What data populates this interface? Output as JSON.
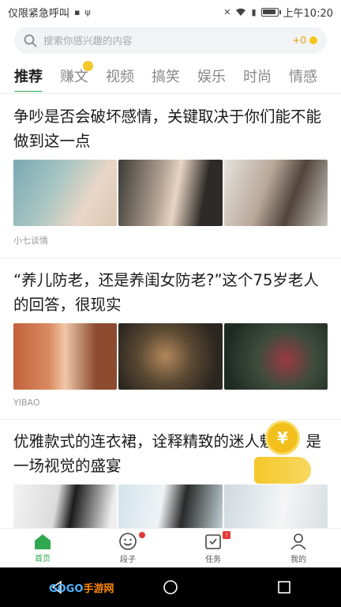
{
  "status_bar": {
    "left_text": "仅限紧急呼叫",
    "time": "上午10:20"
  },
  "search": {
    "placeholder": "搜索你感兴趣的内容",
    "coin_label": "+0"
  },
  "tabs": [
    {
      "label": "推荐",
      "active": true
    },
    {
      "label": "赚文",
      "active": false,
      "badge": true
    },
    {
      "label": "视频",
      "active": false
    },
    {
      "label": "搞笑",
      "active": false
    },
    {
      "label": "娱乐",
      "active": false
    },
    {
      "label": "时尚",
      "active": false
    },
    {
      "label": "情感",
      "active": false
    }
  ],
  "feed": [
    {
      "title": "争吵是否会破坏感情，关键取决于你们能不能做到这一点",
      "source": "小七谈情"
    },
    {
      "title": "“养儿防老，还是养闺女防老?”这个75岁老人的回答，很现实",
      "source": "YIBAO"
    },
    {
      "title": "优雅款式的连衣裙，诠释精致的迷人魅力，是一场视觉的盛宴",
      "source": ""
    }
  ],
  "float_coin": {
    "symbol": "¥"
  },
  "bottom_nav": [
    {
      "label": "首页",
      "icon": "home-icon",
      "active": true
    },
    {
      "label": "段子",
      "icon": "smiley-icon",
      "active": false
    },
    {
      "label": "任务",
      "icon": "task-icon",
      "active": false
    },
    {
      "label": "我的",
      "icon": "user-icon",
      "active": false
    }
  ],
  "watermark": {
    "brand": "GOGO",
    "suffix": "手游网"
  },
  "colors": {
    "accent_green": "#2fa84f",
    "coin_yellow": "#f4c72a",
    "badge_red": "#e53935"
  }
}
